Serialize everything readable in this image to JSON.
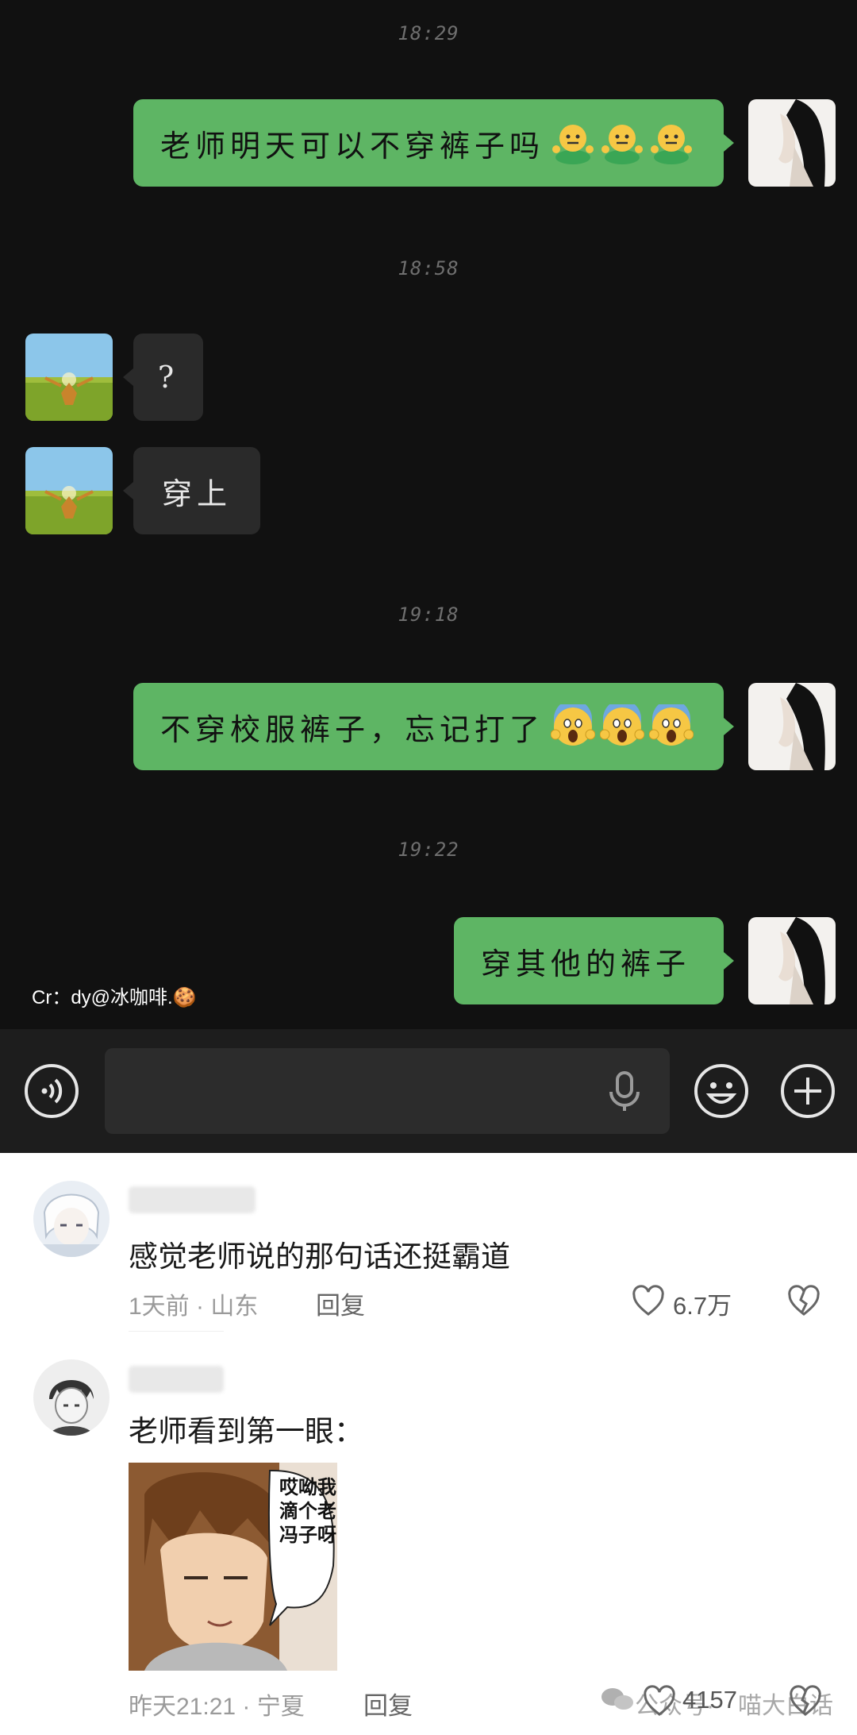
{
  "chat": {
    "timestamps": [
      "18:29",
      "18:58",
      "19:18",
      "19:22"
    ],
    "messages": [
      {
        "side": "right",
        "text": "老师明天可以不穿裤子吗",
        "emoji": "shrug-emoji",
        "emoji_count": 3
      },
      {
        "side": "left",
        "text": "?"
      },
      {
        "side": "left",
        "text": "穿上"
      },
      {
        "side": "right",
        "text": "不穿校服裤子，忘记打了",
        "emoji": "scream-emoji",
        "emoji_count": 3
      },
      {
        "side": "right",
        "text": "穿其他的裤子"
      }
    ],
    "credit": "Cr：dy@冰咖啡.🍪"
  },
  "input_bar": {
    "voice_icon": "voice-toggle-icon",
    "mic_icon": "microphone-icon",
    "emoji_icon": "emoji-face-icon",
    "plus_icon": "plus-circle-icon"
  },
  "comments": [
    {
      "text": "感觉老师说的那句话还挺霸道",
      "time": "1天前",
      "location": "山东",
      "reply": "回复",
      "likes": "6.7万"
    },
    {
      "text": "老师看到第一眼：",
      "meme_text": "哎呦我滴个老冯子呀",
      "time": "昨天21:21",
      "location": "宁夏",
      "reply": "回复",
      "likes": "4157",
      "watermark_left": "公众号·",
      "watermark_right": "喵大白话"
    }
  ],
  "colors": {
    "chat_bg": "#111111",
    "bubble_green": "#5eb564",
    "bubble_dark": "#2a2a2a"
  }
}
